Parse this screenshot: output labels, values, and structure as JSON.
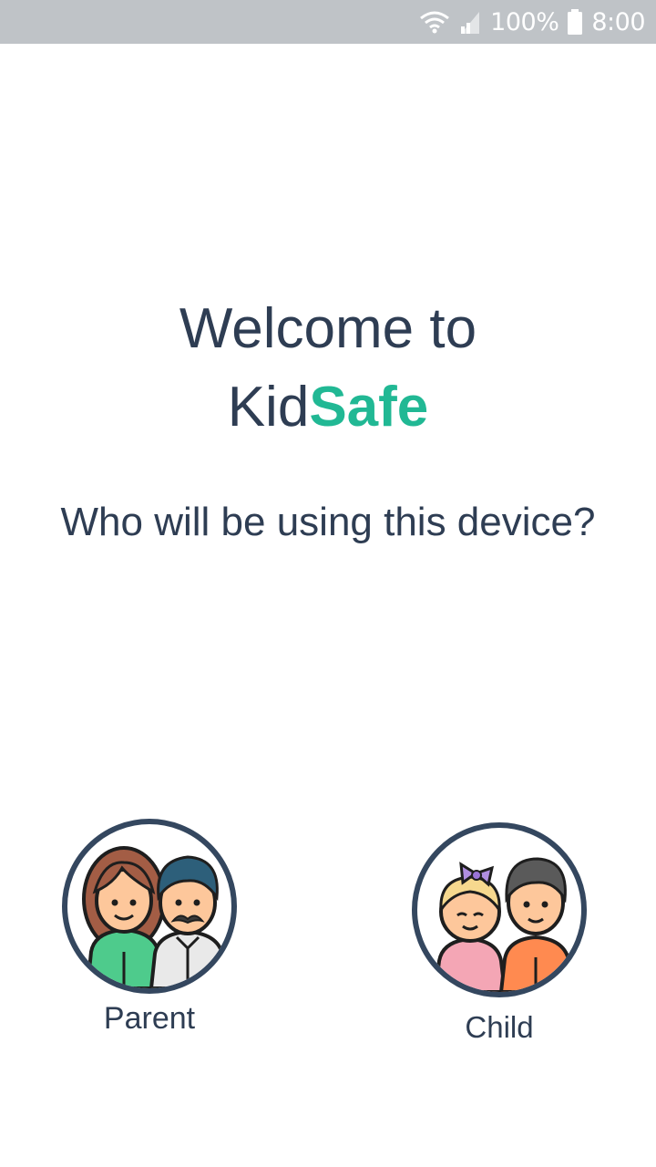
{
  "status_bar": {
    "battery_percent": "100%",
    "time": "8:00",
    "icons": [
      "wifi-icon",
      "signal-icon",
      "battery-icon"
    ]
  },
  "welcome": {
    "line1": "Welcome to",
    "brand_part1": "Kid",
    "brand_part2": "Safe"
  },
  "question": "Who will be using this device?",
  "roles": {
    "parent": {
      "label": "Parent",
      "icon": "parents-avatar-icon"
    },
    "child": {
      "label": "Child",
      "icon": "children-avatar-icon"
    }
  },
  "colors": {
    "text": "#2e3d53",
    "accent": "#21b894",
    "circle_border": "#34475f",
    "status_bar": "#bfc3c7"
  }
}
